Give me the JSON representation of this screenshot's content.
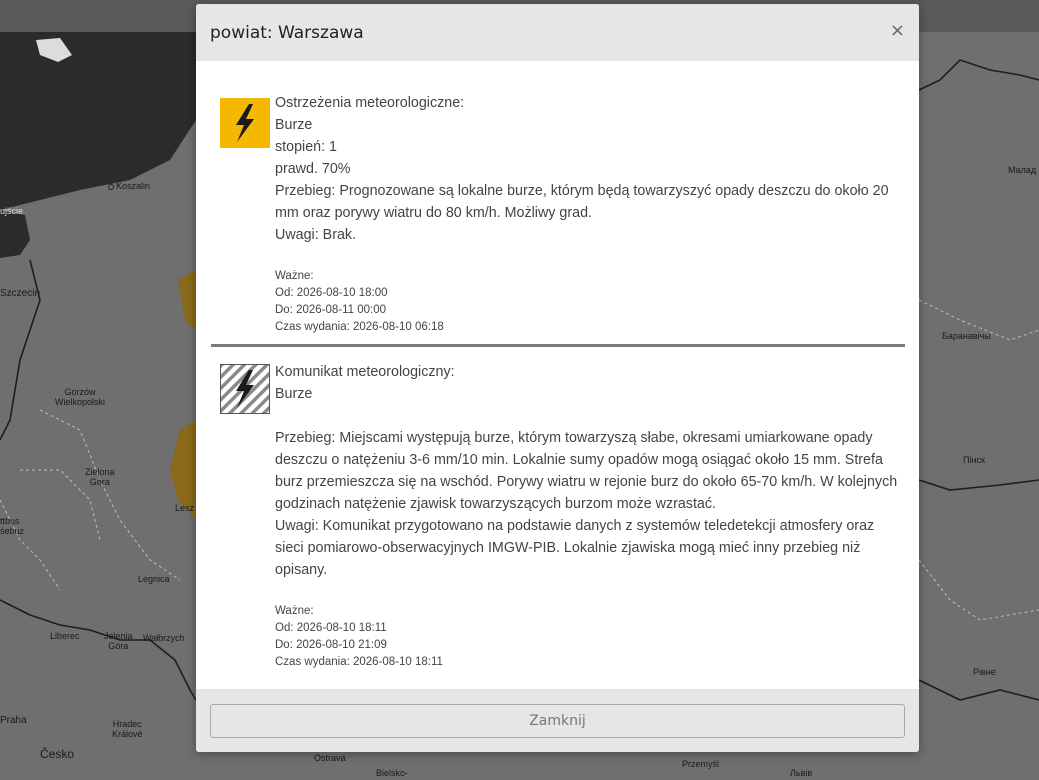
{
  "map": {
    "labels": {
      "koszalin": "Koszalin",
      "szczecin": "Szczecin",
      "gorzow": "Gorzów\nWielkopolski",
      "zielona": "Zielona\nGóra",
      "legnica": "Legnica",
      "liberec": "Liberec",
      "jelenia": "Jelenia\nGóra",
      "walbrzych": "Wałbrzych",
      "praha": "Praha",
      "hradec": "Hradec\nKrálové",
      "cesko": "Česko",
      "ostrava": "Ostrava",
      "bielsko": "Bielsko-",
      "przemysl": "Przemyśl",
      "lviv": "Львів",
      "rivne": "Рівне",
      "pinsk": "Пінск",
      "baranavichy": "Баранавічы",
      "malad": "Малад",
      "leszno": "Lesz",
      "cottbus": "ttbus\nśebuz",
      "ujscie": "ujście"
    }
  },
  "modal": {
    "title": "powiat: Warszawa",
    "close_icon": "×",
    "footer_button": "Zamknij"
  },
  "warnings": [
    {
      "icon": "lightning-icon",
      "icon_style": "solid",
      "icon_color": "#f5b800",
      "lines": [
        "Ostrzeżenia meteorologiczne:",
        "Burze",
        "stopień: 1",
        "prawd. 70%",
        "Przebieg: Prognozowane są lokalne burze, którym będą towarzyszyć opady deszczu do około 20 mm oraz porywy wiatru do 80 km/h. Możliwy grad.",
        "Uwagi: Brak."
      ],
      "validity": {
        "heading": "Ważne:",
        "from": "Od: 2026-08-10 18:00",
        "to": "Do: 2026-08-11 00:00",
        "issued": "Czas wydania: 2026-08-10 06:18"
      }
    },
    {
      "icon": "lightning-icon",
      "icon_style": "hatched",
      "icon_color": "#8a8a8a",
      "lines": [
        "Komunikat meteorologiczny:",
        "Burze"
      ],
      "paragraphs": [
        "Przebieg: Miejscami występują burze, którym towarzyszą słabe, okresami umiarkowane opady deszczu o natężeniu 3-6 mm/10 min. Lokalnie sumy opadów mogą osiągać około 15 mm. Strefa burz przemieszcza się na wschód. Porywy wiatru w rejonie burz do około 65-70 km/h. W kolejnych godzinach natężenie zjawisk towarzyszących burzom może wzrastać.",
        "Uwagi: Komunikat przygotowano na podstawie danych z systemów teledetekcji atmosfery oraz sieci pomiarowo-obserwacyjnych IMGW-PIB. Lokalnie zjawiska mogą mieć inny przebieg niż opisany."
      ],
      "validity": {
        "heading": "Ważne:",
        "from": "Od: 2026-08-10 18:11",
        "to": "Do: 2026-08-10 21:09",
        "issued": "Czas wydania: 2026-08-10 18:11"
      }
    }
  ],
  "colors": {
    "map_land": "#6f6f6f",
    "map_sea": "#2a2a2a",
    "warning_yellow": "#f5b800",
    "map_warning_area": "#8a6a1a"
  }
}
